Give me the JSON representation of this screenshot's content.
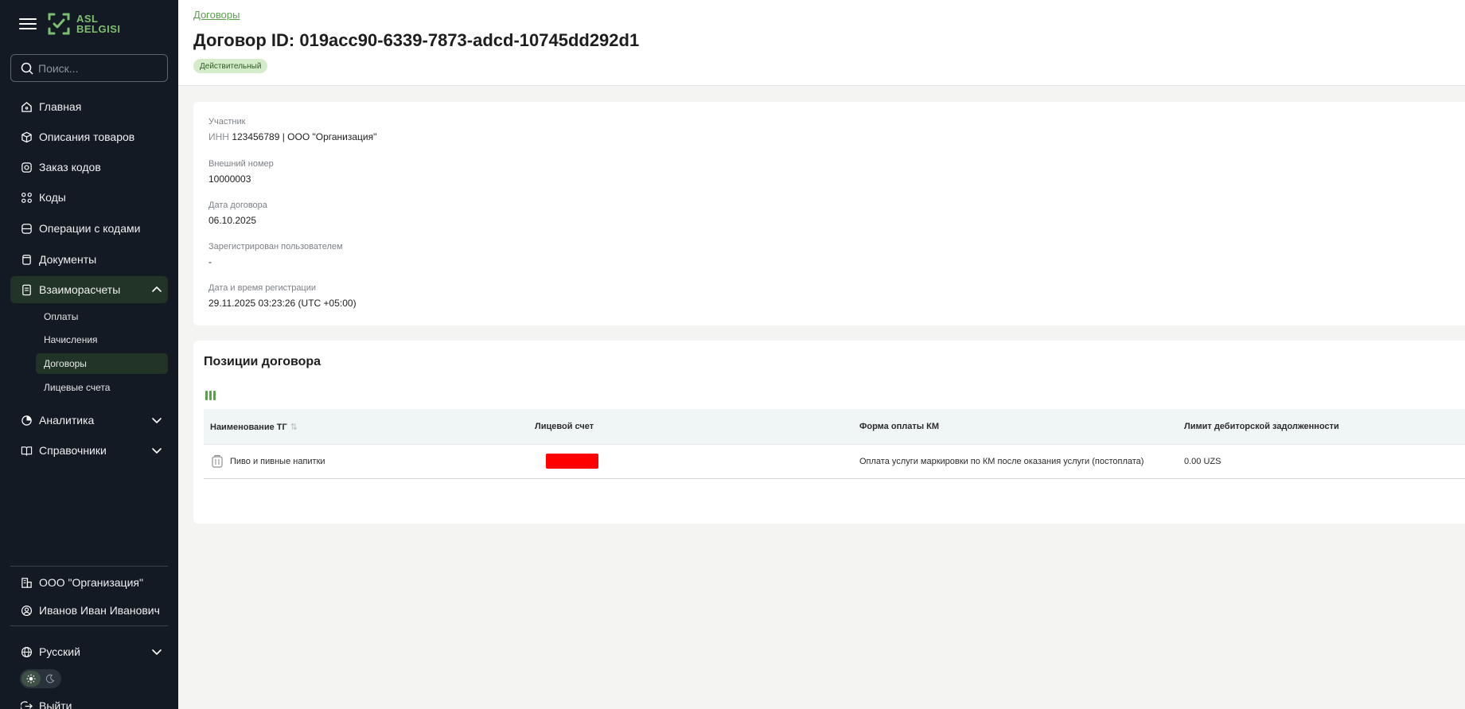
{
  "sidebar": {
    "logo": {
      "line1": "ASL",
      "line2": "BELGISI"
    },
    "search": {
      "placeholder": "Поиск...",
      "value": ""
    },
    "items": [
      {
        "label": "Главная",
        "icon": "home-icon"
      },
      {
        "label": "Описания товаров",
        "icon": "box-icon"
      },
      {
        "label": "Заказ кодов",
        "icon": "order-codes-icon"
      },
      {
        "label": "Коды",
        "icon": "codes-icon"
      },
      {
        "label": "Операции с кодами",
        "icon": "operations-icon"
      },
      {
        "label": "Документы",
        "icon": "documents-icon"
      },
      {
        "label": "Взаиморасчеты",
        "icon": "settlements-icon"
      }
    ],
    "subitems": [
      {
        "label": "Оплаты"
      },
      {
        "label": "Начисления"
      },
      {
        "label": "Договоры"
      },
      {
        "label": "Лицевые счета"
      }
    ],
    "items2": [
      {
        "label": "Аналитика",
        "icon": "analytics-icon"
      },
      {
        "label": "Справочники",
        "icon": "book-icon"
      }
    ],
    "org": "ООО \"Организация\"",
    "user": "Иванов Иван Иванович",
    "language": "Русский",
    "logout": "Выйти"
  },
  "header": {
    "breadcrumb": "Договоры",
    "title": "Договор ID: 019acc90-6339-7873-adcd-10745dd292d1",
    "status": "Действительный"
  },
  "details": {
    "participant_label": "Участник",
    "participant_inn_prefix": "ИНН",
    "participant_value": "123456789 | ООО \"Организация\"",
    "external_number_label": "Внешний номер",
    "external_number": "10000003",
    "contract_date_label": "Дата договора",
    "contract_date": "06.10.2025",
    "registered_by_label": "Зарегистрирован пользователем",
    "registered_by": "-",
    "registration_datetime_label": "Дата и время регистрации",
    "registration_datetime": "29.11.2025 03:23:26 (UTC +05:00)"
  },
  "positions": {
    "title": "Позиции договора",
    "columns": [
      "Наименование ТГ",
      "Лицевой счет",
      "Форма оплаты КМ",
      "Лимит дебиторской задолженности"
    ],
    "rows": [
      {
        "name": "Пиво и пивные напитки",
        "account": "",
        "payment_form": "Оплата услуги маркировки по КМ после оказания услуги (постоплата)",
        "limit": "0.00 UZS"
      }
    ]
  },
  "colors": {
    "sidebar_bg": "#131a24",
    "accent": "#5aa04e",
    "active_item_bg": "#223427",
    "badge_bg": "#d4ecc9",
    "redaction": "#ff0000"
  }
}
